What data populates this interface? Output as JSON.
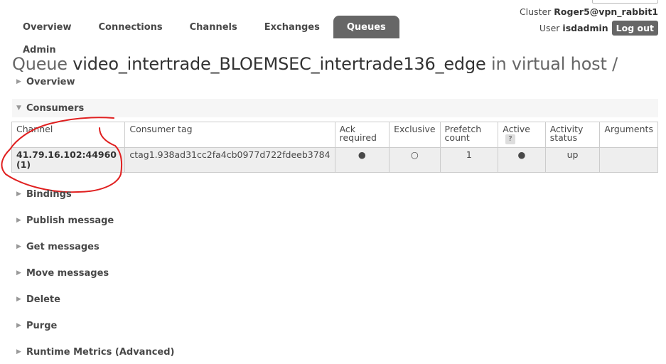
{
  "header": {
    "cluster_label": "Cluster",
    "cluster_name": "Roger5@vpn_rabbit1",
    "user_label": "User",
    "user_name": "isdadmin",
    "logout_label": "Log out"
  },
  "tabs": [
    {
      "label": "Overview"
    },
    {
      "label": "Connections"
    },
    {
      "label": "Channels"
    },
    {
      "label": "Exchanges"
    },
    {
      "label": "Queues"
    }
  ],
  "tab_admin": "Admin",
  "title": {
    "prefix": "Queue",
    "name": "video_intertrade_BLOEMSEC_intertrade136_edge",
    "suffix": "in virtual host /"
  },
  "sections": {
    "overview": "Overview",
    "consumers": "Consumers",
    "bindings": "Bindings",
    "publish": "Publish message",
    "get": "Get messages",
    "move": "Move messages",
    "delete": "Delete",
    "purge": "Purge",
    "runtime": "Runtime Metrics (Advanced)"
  },
  "consumers_table": {
    "headers": {
      "channel": "Channel",
      "consumer_tag": "Consumer tag",
      "ack_line1": "Ack",
      "ack_line2": "required",
      "exclusive": "Exclusive",
      "prefetch_line1": "Prefetch",
      "prefetch_line2": "count",
      "active": "Active",
      "active_help": "?",
      "activity_line1": "Activity",
      "activity_line2": "status",
      "arguments": "Arguments"
    },
    "row": {
      "channel_line1": "41.79.16.102:44960",
      "channel_line2": "(1)",
      "consumer_tag": "ctag1.938ad31cc2fa4cb0977d722fdeeb3784",
      "ack_required": "●",
      "exclusive": "○",
      "prefetch_count": "1",
      "active": "●",
      "activity_status": "up",
      "arguments": ""
    }
  },
  "annotation": {
    "color": "#e02020"
  }
}
